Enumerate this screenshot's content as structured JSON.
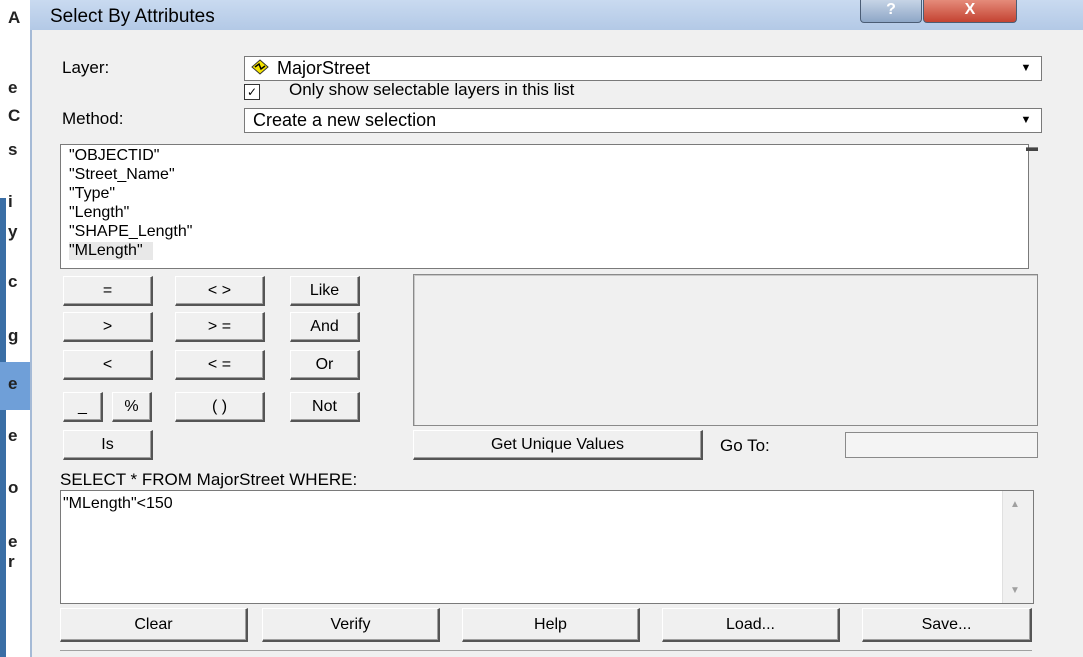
{
  "dialog": {
    "title": "Select By Attributes",
    "help_glyph": "?",
    "close_glyph": "X"
  },
  "layer": {
    "label": "Layer:",
    "selected": "MajorStreet",
    "icon": "layer-polyline-icon"
  },
  "selectable_only": {
    "checked": true,
    "label": "Only show selectable layers in this list"
  },
  "method": {
    "label": "Method:",
    "selected": "Create a new selection"
  },
  "fields": [
    "\"OBJECTID\"",
    "\"Street_Name\"",
    "\"Type\"",
    "\"Length\"",
    "\"SHAPE_Length\"",
    "\"MLength\""
  ],
  "selected_field_index": 5,
  "operators": {
    "eq": "=",
    "ne": "< >",
    "like": "Like",
    "gt": ">",
    "ge": "> =",
    "and": "And",
    "lt": "<",
    "le": "< =",
    "or": "Or",
    "underscore": "_",
    "percent": "%",
    "parens": "( )",
    "not": "Not",
    "is": "Is"
  },
  "get_unique_values": "Get Unique Values",
  "goto_label": "Go To:",
  "goto_value": "",
  "sql_label": "SELECT * FROM MajorStreet WHERE:",
  "sql_expression": "\"MLength\"<150",
  "bottom_buttons": {
    "clear": "Clear",
    "verify": "Verify",
    "help": "Help",
    "load": "Load...",
    "save": "Save..."
  },
  "background_glyphs": [
    "A",
    "e",
    "C",
    "s",
    "i",
    "y",
    "c",
    "g",
    "e",
    "e",
    "o",
    "e",
    "r"
  ],
  "colors": {
    "titlebar": "#b3c9e6",
    "close_button": "#c44332",
    "dialog_bg": "#f0f0f0"
  }
}
